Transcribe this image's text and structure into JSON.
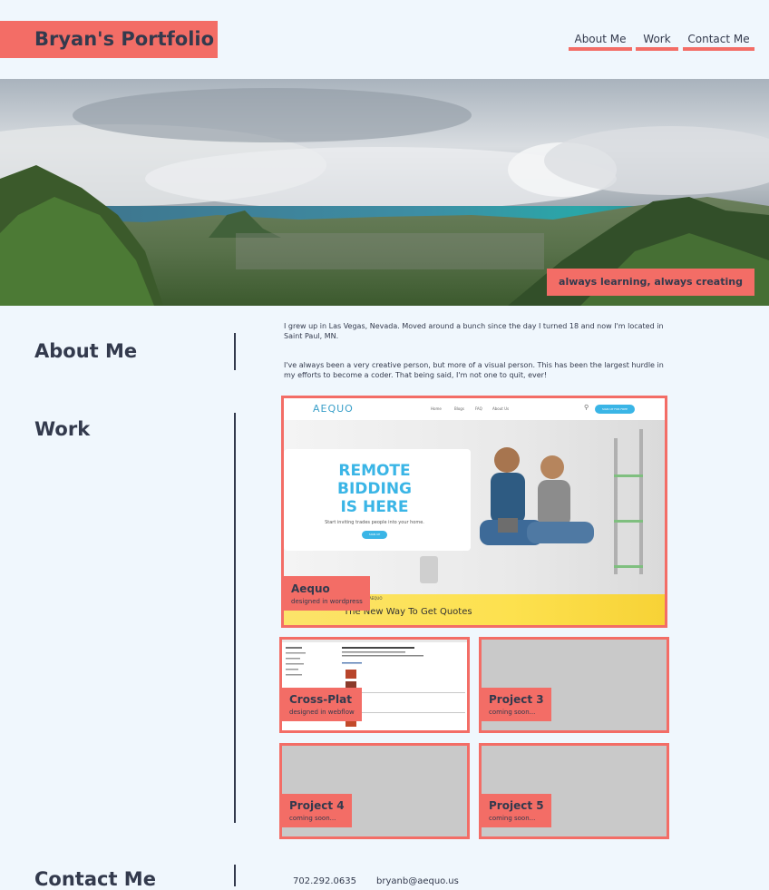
{
  "header": {
    "logo_text": "Bryan's Portfolio",
    "nav": [
      {
        "label": "About Me"
      },
      {
        "label": "Work"
      },
      {
        "label": "Contact Me"
      }
    ]
  },
  "hero": {
    "tagline": "always learning, always creating"
  },
  "about": {
    "title": "About Me",
    "paragraph_1": "I grew up in Las Vegas, Nevada. Moved around a bunch since the day I turned 18 and now I'm located in Saint Paul, MN.",
    "paragraph_2": "I've always been a very creative person, but more of a visual person. This has been the largest hurdle in my efforts to become a coder. That being said, I'm not one to quit, ever!"
  },
  "work": {
    "title": "Work",
    "featured": {
      "title": "Aequo",
      "subtitle": "designed in wordpress",
      "screenshot": {
        "brand": "AEQUO",
        "nav_items": [
          "Home",
          "Blogs",
          "FAQ",
          "About Us"
        ],
        "cta": "SIGN UP FOR FREE",
        "headline_1": "REMOTE",
        "headline_2": "BIDDING",
        "headline_3": "IS HERE",
        "subtext": "Start inviting trades people into your home.",
        "button": "SIGN UP",
        "banner_small": "AEQUO",
        "banner_text": "The New Way To Get Quotes"
      }
    },
    "projects": [
      {
        "title": "Cross-Plat",
        "subtitle": "designed in webflow"
      },
      {
        "title": "Project 3",
        "subtitle": "coming soon..."
      },
      {
        "title": "Project 4",
        "subtitle": "coming soon..."
      },
      {
        "title": "Project 5",
        "subtitle": "coming soon..."
      }
    ]
  },
  "contact": {
    "title": "Contact Me",
    "phone": "702.292.0635",
    "email": "bryanb@aequo.us"
  },
  "colors": {
    "accent": "#f36d66",
    "text": "#333a4d",
    "background": "#f0f7fd",
    "placeholder": "#c9c9c9"
  }
}
